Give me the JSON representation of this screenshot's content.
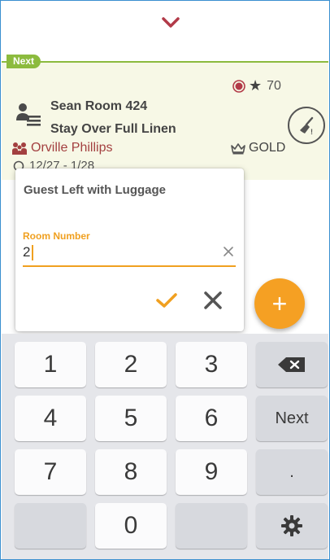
{
  "top": {
    "collapse_icon": "chevron-down-icon",
    "accent": "#b23a48"
  },
  "card": {
    "tag": "Next",
    "room": "Sean Room 424",
    "service": "Stay Over Full Linen",
    "points": "70",
    "guest": "Orville Phillips",
    "tier": "GOLD",
    "dates": "12/27 - 1/28",
    "accent": "#8cbb3e",
    "bg": "#f7f8e6"
  },
  "dialog": {
    "title": "Guest Left with Luggage",
    "field_label": "Room Number",
    "field_value": "2",
    "accent": "#f0a020"
  },
  "fab": {
    "label": "+",
    "color": "#f5a023"
  },
  "keyboard": {
    "rows": [
      [
        "1",
        "2",
        "3",
        "backspace"
      ],
      [
        "4",
        "5",
        "6",
        "Next"
      ],
      [
        "7",
        "8",
        "9",
        "."
      ],
      [
        "",
        "0",
        "",
        "settings"
      ]
    ],
    "next_label": "Next",
    "dot_label": "."
  }
}
